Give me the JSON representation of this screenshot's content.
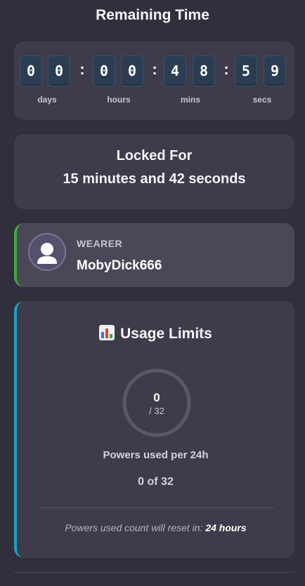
{
  "header": {
    "title": "Remaining Time"
  },
  "timer": {
    "digits": [
      "0",
      "0",
      "0",
      "0",
      "4",
      "8",
      "5",
      "9"
    ],
    "separator": ":",
    "units": [
      "days",
      "hours",
      "mins",
      "secs"
    ]
  },
  "locked": {
    "title": "Locked For",
    "value": "15 minutes and 42 seconds"
  },
  "wearer": {
    "label": "WEARER",
    "name": "MobyDick666",
    "accent_color": "#3fa945",
    "icon": "user-avatar-icon"
  },
  "usage": {
    "icon": "bar-chart-icon",
    "heading": "Usage Limits",
    "used": "0",
    "total_text": "/ 32",
    "used_fraction": 0,
    "powers_label": "Powers used per 24h",
    "count_text": "0 of 32",
    "reset_prefix": "Powers used count will reset in:",
    "reset_value": "24 hours",
    "accent_color": "#1aa1c4"
  }
}
